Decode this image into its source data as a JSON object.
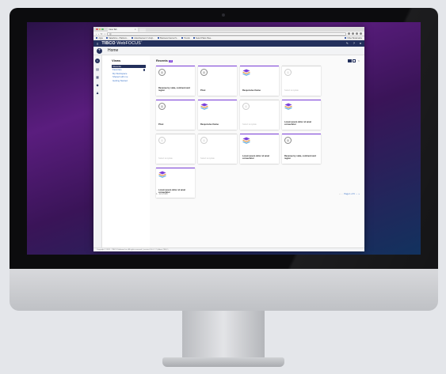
{
  "browser": {
    "tab_title": "New Tab",
    "tab_close": "×",
    "url": "Q",
    "bookmarks": [
      {
        "label": "Apps"
      },
      {
        "label": "Salesforce - Platinum..."
      },
      {
        "label": "Advertisement / Unspl..."
      },
      {
        "label": "Business Internet S..."
      },
      {
        "label": "Trends"
      },
      {
        "label": "Select Plans: Bea..."
      }
    ],
    "other_bookmarks": "Other Bookmarks"
  },
  "app": {
    "brand_bold": "TIBCO",
    "brand_rest": " WebFOCUS",
    "brand_mark": "®",
    "page_title": "Home",
    "new_icon": "+"
  },
  "views": {
    "title": "Views",
    "items": [
      {
        "label": "Recents",
        "active": true
      },
      {
        "label": "Favorites",
        "dot": true
      },
      {
        "label": "My Workspace"
      },
      {
        "label": "Shared with me"
      },
      {
        "label": "Getting Started"
      }
    ]
  },
  "recents": {
    "title": "Recents",
    "badge": "12",
    "items": [
      {
        "name": "Revenue by state, continent and region",
        "icon": "chart-icon",
        "missing": false
      },
      {
        "name": "Pivot",
        "icon": "chart-icon",
        "missing": false
      },
      {
        "name": "Responsive theme",
        "icon": "layers-icon",
        "missing": false
      },
      {
        "name": "Select template",
        "icon": "chart-icon",
        "missing": true
      },
      {
        "name": "Pivot",
        "icon": "chart-icon",
        "missing": false
      },
      {
        "name": "Responsive theme",
        "icon": "layers-icon",
        "missing": false
      },
      {
        "name": "Select template",
        "icon": "chart-icon",
        "missing": true
      },
      {
        "name": "Lorem ipsum dolor sit amet consectetur",
        "icon": "layers-icon",
        "missing": false
      },
      {
        "name": "Select template",
        "icon": "chart-icon",
        "missing": true
      },
      {
        "name": "Select template",
        "icon": "chart-icon",
        "missing": true
      },
      {
        "name": "Lorem ipsum dolor sit amet consectetur",
        "icon": "layers-icon",
        "missing": false
      },
      {
        "name": "Revenue by state, continent and region",
        "icon": "chart-icon",
        "missing": false
      },
      {
        "name": "Lorem ipsum dolor sit amet consectetur",
        "icon": "layers-icon",
        "missing": false
      }
    ],
    "range_text": "1 - 12 of 100",
    "page_text": "Page 1 of 9"
  },
  "status_bar": "Copyright © 2021 · TIBCO Software Inc. All rights reserved. | version 9.0.0 ·17 | About TIBCO",
  "colors": {
    "nav_dark": "#23305c",
    "accent": "#7b3fd9",
    "link": "#3b74c9"
  }
}
